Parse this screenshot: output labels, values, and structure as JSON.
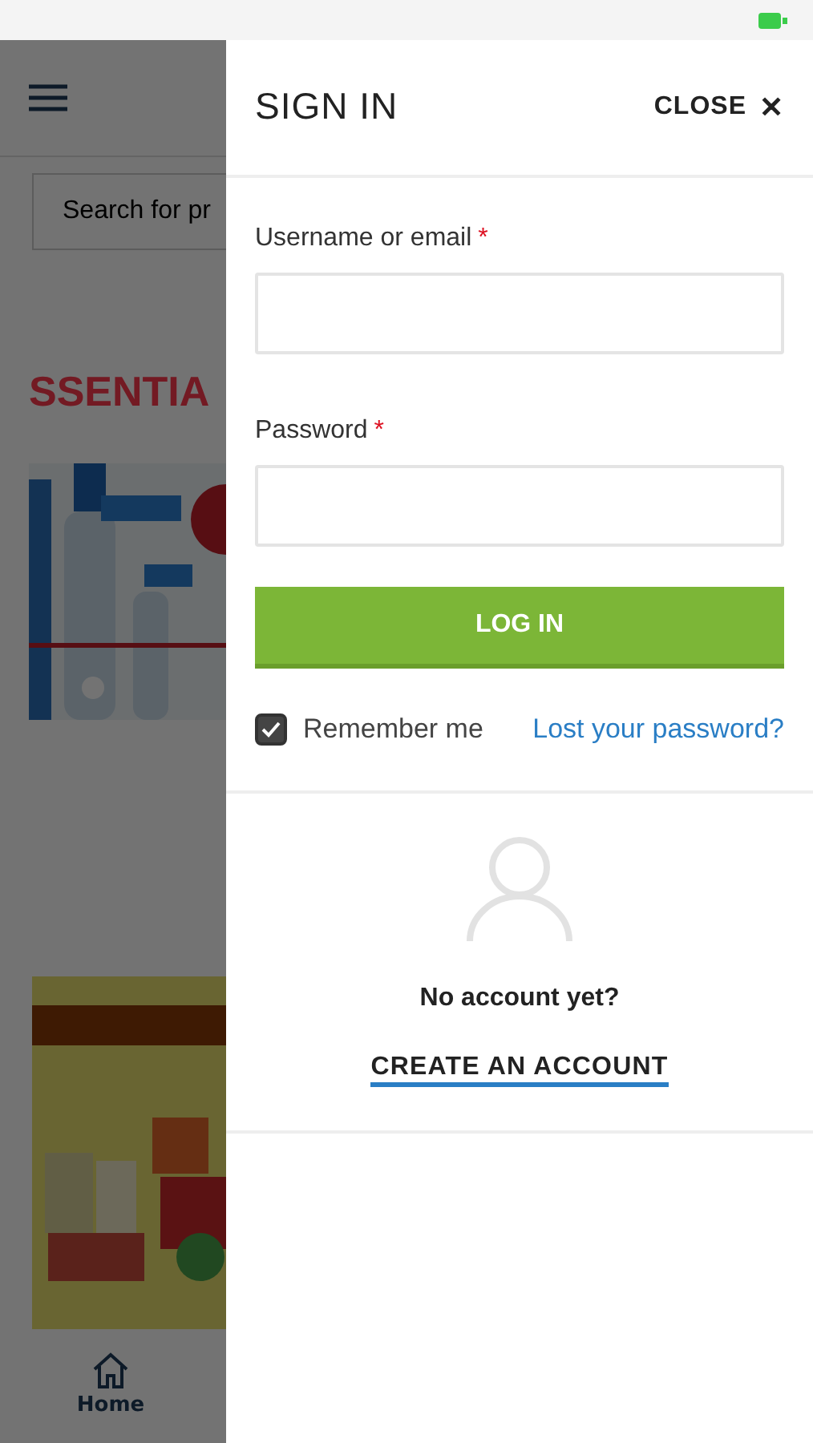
{
  "background_page": {
    "search": {
      "placeholder": "Search for pr"
    },
    "banner_heading": "SSENTIA",
    "bottom_nav": [
      {
        "label": "Home",
        "selected": true
      }
    ]
  },
  "sign_in_panel": {
    "title": "SIGN IN",
    "close_label": "CLOSE",
    "close_icon": "✕",
    "fields": [
      {
        "label": "Username or email",
        "required_mark": "*"
      },
      {
        "label": "Password",
        "required_mark": "*"
      }
    ],
    "login_button": "LOG IN",
    "remember_me": {
      "label": "Remember me",
      "checked": true
    },
    "lost_password_link": "Lost your password?",
    "no_account_text": "No account yet?",
    "create_account_link": "CREATE AN ACCOUNT"
  }
}
